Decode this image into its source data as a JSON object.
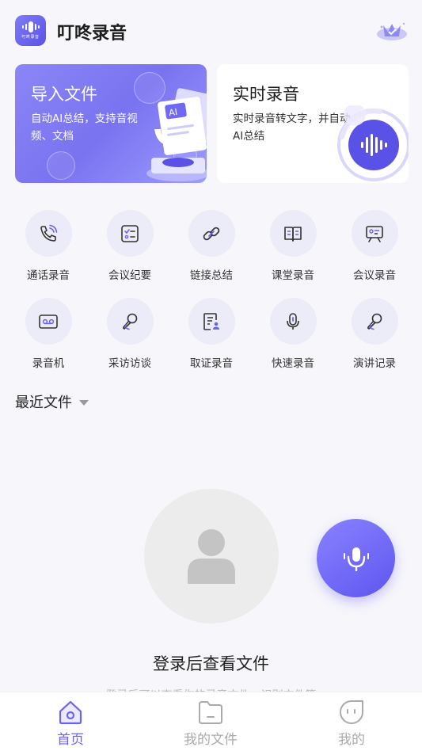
{
  "app": {
    "title": "叮咚录音",
    "logo_text": "叮咚录音"
  },
  "cards": {
    "import": {
      "title": "导入文件",
      "desc": "自动AI总结，支持音视频、文档",
      "illus_text": "AI"
    },
    "record": {
      "title": "实时录音",
      "desc": "实时录音转文字，并自动AI总结"
    }
  },
  "functions": [
    {
      "label": "通话录音",
      "icon": "phone-call-icon"
    },
    {
      "label": "会议纪要",
      "icon": "checklist-icon"
    },
    {
      "label": "链接总结",
      "icon": "link-icon"
    },
    {
      "label": "课堂录音",
      "icon": "book-icon"
    },
    {
      "label": "会议录音",
      "icon": "presentation-icon"
    },
    {
      "label": "录音机",
      "icon": "cassette-icon"
    },
    {
      "label": "采访访谈",
      "icon": "handheld-mic-icon"
    },
    {
      "label": "取证录音",
      "icon": "document-user-icon"
    },
    {
      "label": "快速录音",
      "icon": "mic-icon"
    },
    {
      "label": "演讲记录",
      "icon": "handheld-mic-icon"
    }
  ],
  "recent": {
    "label": "最近文件"
  },
  "empty": {
    "title": "登录后查看文件",
    "subtitle": "登录后可以查看你的录音文件、识别文件等"
  },
  "tabs": [
    {
      "label": "首页",
      "icon": "home-icon",
      "active": true
    },
    {
      "label": "我的文件",
      "icon": "folder-icon",
      "active": false
    },
    {
      "label": "我的",
      "icon": "profile-face-icon",
      "active": false
    }
  ],
  "colors": {
    "accent": "#6b63f2",
    "background": "#f6f6fb",
    "icon_bg": "#ececf8"
  }
}
